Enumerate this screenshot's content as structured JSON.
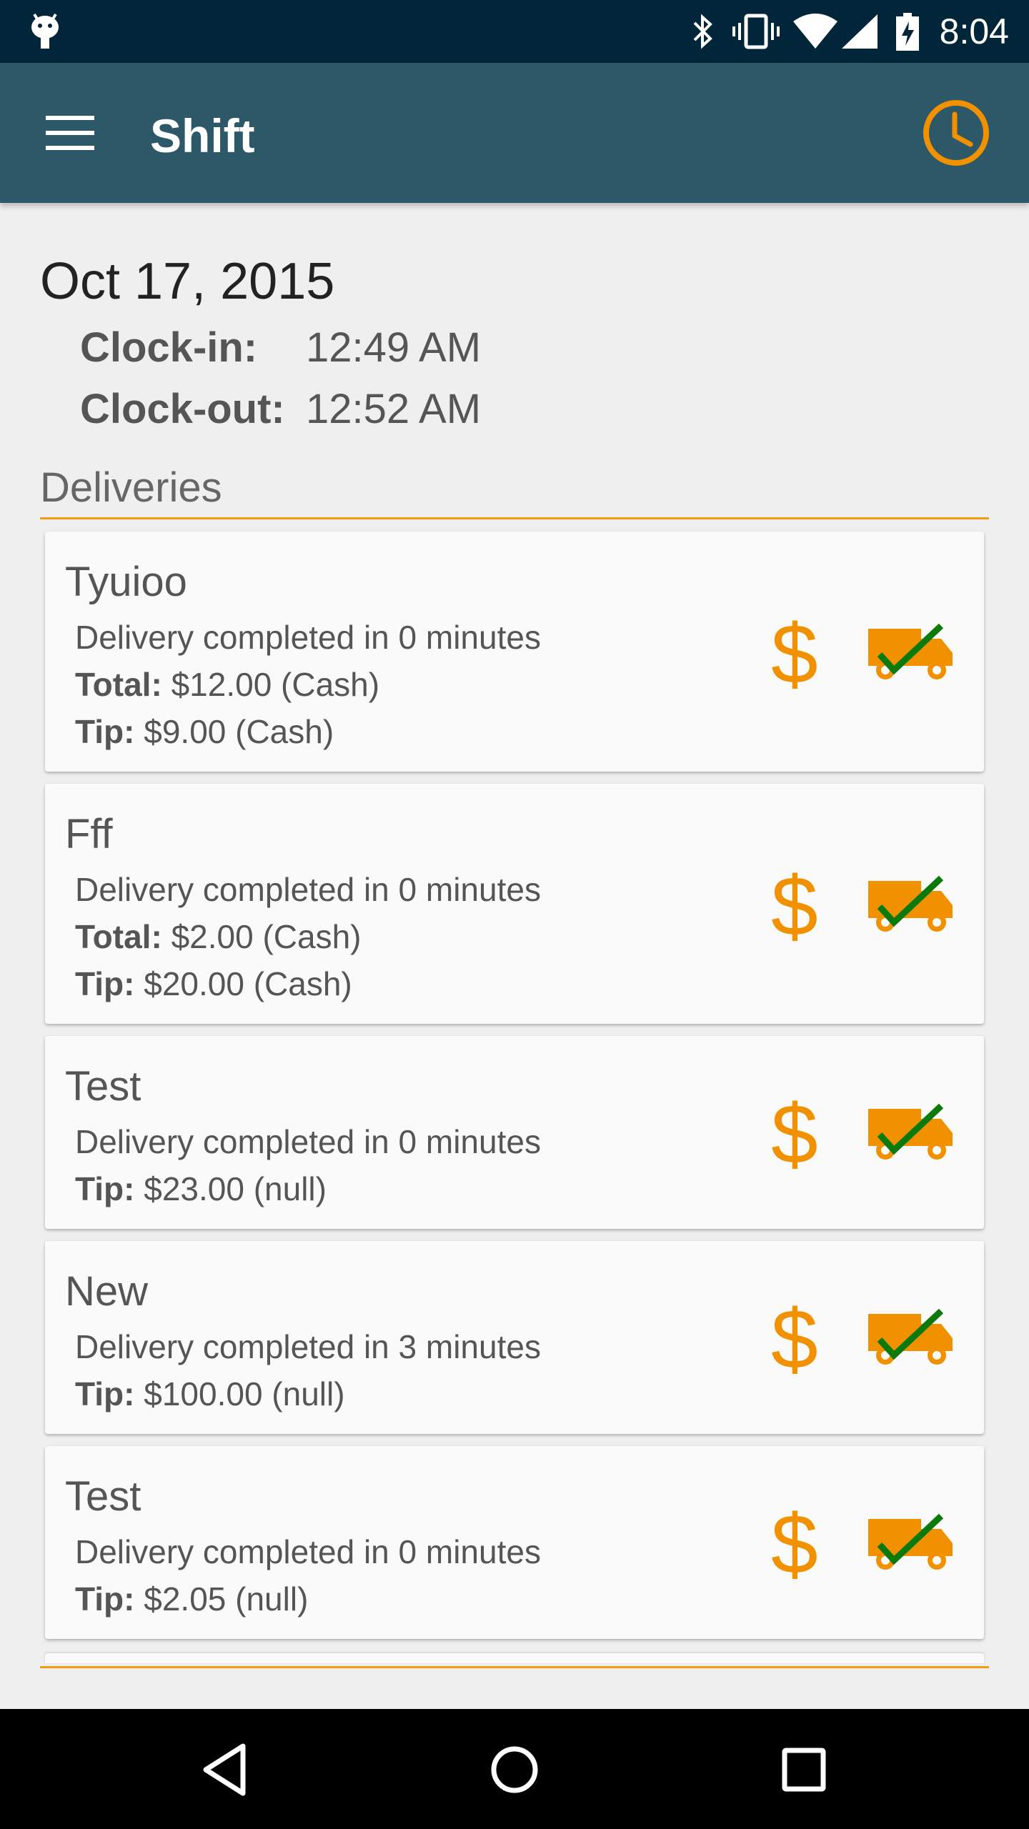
{
  "status_bar": {
    "time": "8:04",
    "icons": [
      "android-icon",
      "bluetooth-icon",
      "vibrate-icon",
      "wifi-icon",
      "signal-icon",
      "battery-charging-icon"
    ]
  },
  "app_bar": {
    "title": "Shift",
    "menu_icon": "hamburger-menu-icon",
    "action_icon": "clock-icon",
    "accent_color": "#f29100",
    "background_color": "#2d5868"
  },
  "shift": {
    "date": "Oct 17, 2015",
    "clock_in_label": "Clock-in:",
    "clock_in_value": "12:49 AM",
    "clock_out_label": "Clock-out:",
    "clock_out_value": "12:52 AM"
  },
  "deliveries": {
    "section_title": "Deliveries",
    "items": [
      {
        "name": "Tyuioo",
        "duration": "Delivery completed in 0 minutes",
        "total_label": "Total:",
        "total_value": "$12.00 (Cash)",
        "tip_label": "Tip:",
        "tip_value": "$9.00 (Cash)",
        "payment_icon": "$"
      },
      {
        "name": "Fff",
        "duration": "Delivery completed in 0 minutes",
        "total_label": "Total:",
        "total_value": "$2.00 (Cash)",
        "tip_label": "Tip:",
        "tip_value": "$20.00 (Cash)",
        "payment_icon": "$"
      },
      {
        "name": "Test",
        "duration": "Delivery completed in 0 minutes",
        "tip_label": "Tip:",
        "tip_value": "$23.00 (null)",
        "payment_icon": "$"
      },
      {
        "name": "New",
        "duration": "Delivery completed in 3 minutes",
        "tip_label": "Tip:",
        "tip_value": "$100.00 (null)",
        "payment_icon": "$"
      },
      {
        "name": "Test",
        "duration": "Delivery completed in 0 minutes",
        "tip_label": "Tip:",
        "tip_value": "$2.05 (null)",
        "payment_icon": "$"
      }
    ]
  },
  "nav_bar": {
    "buttons": [
      "back-icon",
      "home-icon",
      "recents-icon"
    ]
  }
}
